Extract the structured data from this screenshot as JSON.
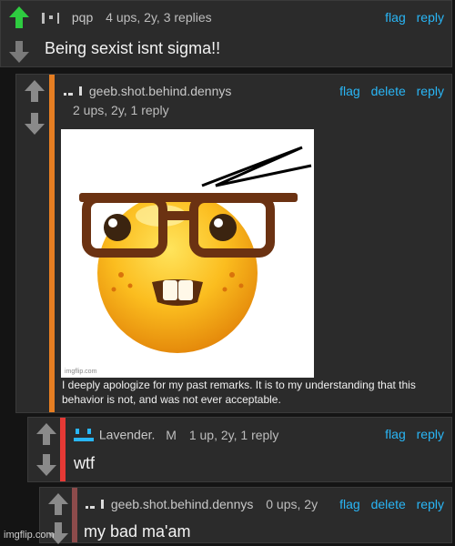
{
  "comments": [
    {
      "username": "pqp",
      "info": "4 ups, 2y, 3 replies",
      "actions": [
        "flag",
        "reply"
      ],
      "body": "Being sexist isnt sigma!!",
      "vote_state": "upvoted",
      "accent": "#2ecc40"
    },
    {
      "username": "geeb.shot.behind.dennys",
      "info": "2 ups, 2y, 1 reply",
      "actions": [
        "flag",
        "delete",
        "reply"
      ],
      "accent": "#e67e22",
      "image_caption": "I deeply apologize for my past remarks. It is to my understanding that this behavior is not, and was not ever acceptable.",
      "image_watermark": "imgflip.com",
      "image_subject": "nerd-face-emoji"
    },
    {
      "username": "Lavender.",
      "badge": "M",
      "info": "1 up, 2y, 1 reply",
      "actions": [
        "flag",
        "reply"
      ],
      "body": "wtf",
      "accent": "#e53935",
      "avatar_color": "#29b6f6"
    },
    {
      "username": "geeb.shot.behind.dennys",
      "info": "0 ups, 2y",
      "actions": [
        "flag",
        "delete",
        "reply"
      ],
      "body": "my bad ma'am",
      "accent": "#8d4b4b"
    }
  ],
  "watermark": "imgflip.com",
  "colors": {
    "link": "#29b6f6",
    "upvote": "#2ecc40",
    "downvote_active": "#888888"
  }
}
